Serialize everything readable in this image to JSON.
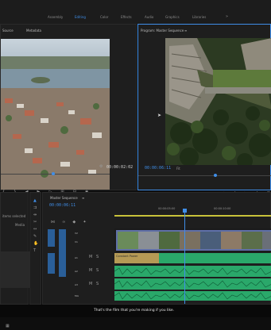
{
  "topbar": {
    "workspaces": [
      "Assembly",
      "Editing",
      "Color",
      "Effects",
      "Audio",
      "Graphics",
      "Libraries"
    ],
    "active_workspace": "Editing",
    "more_label": "»"
  },
  "source_panel": {
    "tabs": [
      "Source",
      "Metadata"
    ],
    "timecode": "00:00:02:02"
  },
  "program_monitor": {
    "title": "Program: Master Sequence",
    "timecode": "00:00:06:11",
    "fit_label": "Fit"
  },
  "project_panel": {
    "items_selected": "items selected",
    "media_label": "Media"
  },
  "timeline": {
    "tab": "Master Sequence",
    "timecode": "00:00:06:11",
    "ruler": [
      "00:00:05:00",
      "00:00:10:00"
    ],
    "tracks": [
      "V2",
      "V1",
      "A1",
      "A2",
      "A3",
      "Mix"
    ],
    "clip_label": "Constant Power"
  },
  "subtitle": "That's the film that you're making if you like.",
  "colors": {
    "accent": "#3f8ee8",
    "video_clip": "#5f6fa8",
    "audio_clip": "#2aa86a",
    "transition": "#b59a55"
  }
}
